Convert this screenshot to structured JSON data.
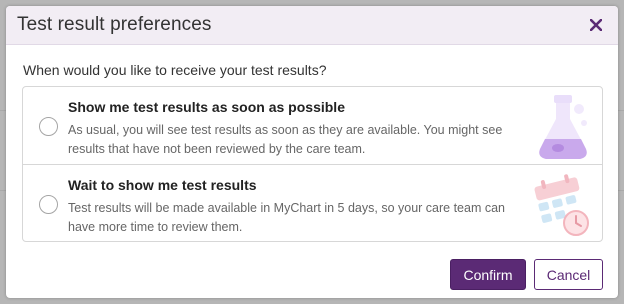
{
  "dialog": {
    "title": "Test result preferences",
    "close_icon": "close-icon",
    "question": "When would you like to receive your test results?"
  },
  "options": [
    {
      "title": "Show me test results as soon as possible",
      "description": "As usual, you will see test results as soon as they are available. You might see results that have not been reviewed by the care team.",
      "icon": "flask-icon",
      "selected": false
    },
    {
      "title": "Wait to show me test results",
      "description": "Test results will be made available in MyChart in 5 days, so your care team can have more time to review them.",
      "icon": "calendar-clock-icon",
      "selected": false
    }
  ],
  "buttons": {
    "confirm": "Confirm",
    "cancel": "Cancel"
  },
  "colors": {
    "accent": "#5b2a75",
    "header_bg": "#f2edf4",
    "illustration_lavender": "#e9defa",
    "illustration_pink": "#f7cfd5",
    "illustration_blue": "#cfe6f5"
  }
}
